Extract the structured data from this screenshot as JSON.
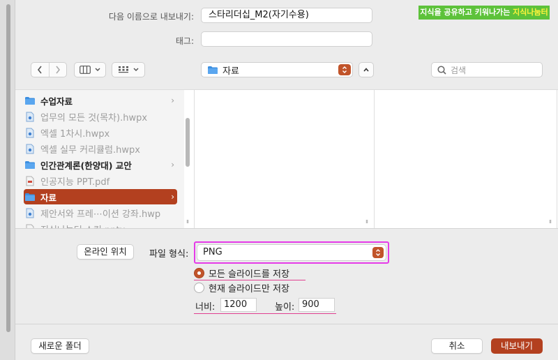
{
  "header": {
    "save_as_label": "다음 이름으로 내보내기:",
    "save_as_value": "스타리더십_M2(자기수용)",
    "tags_label": "태그:",
    "tags_value": "",
    "banner": {
      "prefix": "지식을 공유하고 키워나가는 ",
      "highlight": "지식나눔터"
    }
  },
  "toolbar": {
    "location_folder": "자료",
    "search_placeholder": "검색",
    "icons": {
      "back": "chevron-left-icon",
      "forward": "chevron-right-icon",
      "view_columns": "columns-view-icon",
      "view_grid": "grid-view-icon",
      "folder": "folder-icon",
      "search": "magnifier-icon"
    }
  },
  "sidebar": {
    "items": [
      {
        "label": "수업자료",
        "kind": "folder",
        "has_children": true,
        "selected": false
      },
      {
        "label": "업무의 모든 것(목차).hwpx",
        "kind": "doc",
        "has_children": false,
        "selected": false
      },
      {
        "label": "엑셀 1차시.hwpx",
        "kind": "doc",
        "has_children": false,
        "selected": false
      },
      {
        "label": "엑셀 실무 커리큘럼.hwpx",
        "kind": "doc",
        "has_children": false,
        "selected": false
      },
      {
        "label": "인간관계론(한양대) 교안",
        "kind": "folder",
        "has_children": true,
        "selected": false
      },
      {
        "label": "인공지능 PPT.pdf",
        "kind": "doc",
        "has_children": false,
        "selected": false
      },
      {
        "label": "자료",
        "kind": "folder",
        "has_children": true,
        "selected": true
      },
      {
        "label": "제안서와 프레⋯이션 강좌.hwp",
        "kind": "doc",
        "has_children": false,
        "selected": false
      },
      {
        "label": "지식나눔터 스킨.pptx",
        "kind": "doc",
        "has_children": false,
        "selected": false
      }
    ]
  },
  "options": {
    "online_location_button": "온라인 위치",
    "format_label": "파일 형식:",
    "format_value": "PNG",
    "radio_all": "모든 슬라이드를 저장",
    "radio_current": "현재 슬라이드만 저장",
    "width_label": "너비:",
    "width_value": "1200",
    "height_label": "높이:",
    "height_value": "900",
    "selected_radio": "all"
  },
  "footer": {
    "new_folder_button": "새로운 폴더",
    "cancel_button": "취소",
    "export_button": "내보내기"
  },
  "colors": {
    "accent": "#b3401f",
    "stepper": "#c1542a",
    "highlight": "#e53be8",
    "banner_bg": "#5dc23a",
    "banner_highlight": "#fff33b",
    "folder_blue": "#3d8fe0"
  }
}
